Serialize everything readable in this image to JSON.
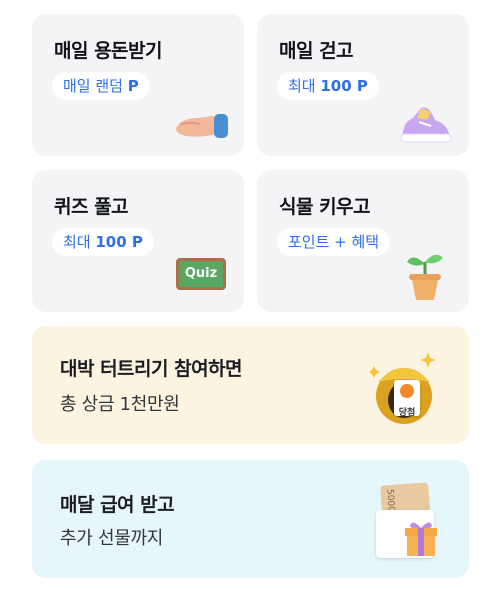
{
  "cards": [
    {
      "title": "매일 용돈받기",
      "badge_prefix": "매일 랜덤 ",
      "badge_value": "P"
    },
    {
      "title": "매일 걷고",
      "badge_prefix": "최대 ",
      "badge_value": "100 P"
    },
    {
      "title": "퀴즈 풀고",
      "badge_prefix": "최대 ",
      "badge_value": "100 P"
    },
    {
      "title": "식물 키우고",
      "badge_prefix": "포인트 + 혜택",
      "badge_value": ""
    }
  ],
  "banners": [
    {
      "title": "대박 터트리기 참여하면",
      "subtitle": "총 상금 1천만원"
    },
    {
      "title": "매달 급여 받고",
      "subtitle": "추가 선물까지"
    }
  ],
  "illustrations": {
    "quiz_board_text": "Quiz",
    "gold_pot_label": "당첨",
    "envelope_bill_text": "5000"
  },
  "colors": {
    "card_bg": "#f4f4f6",
    "badge_text": "#2f6fe6",
    "banner_lottery_bg": "#fcf3e0",
    "banner_salary_bg": "#e5f6fd"
  }
}
